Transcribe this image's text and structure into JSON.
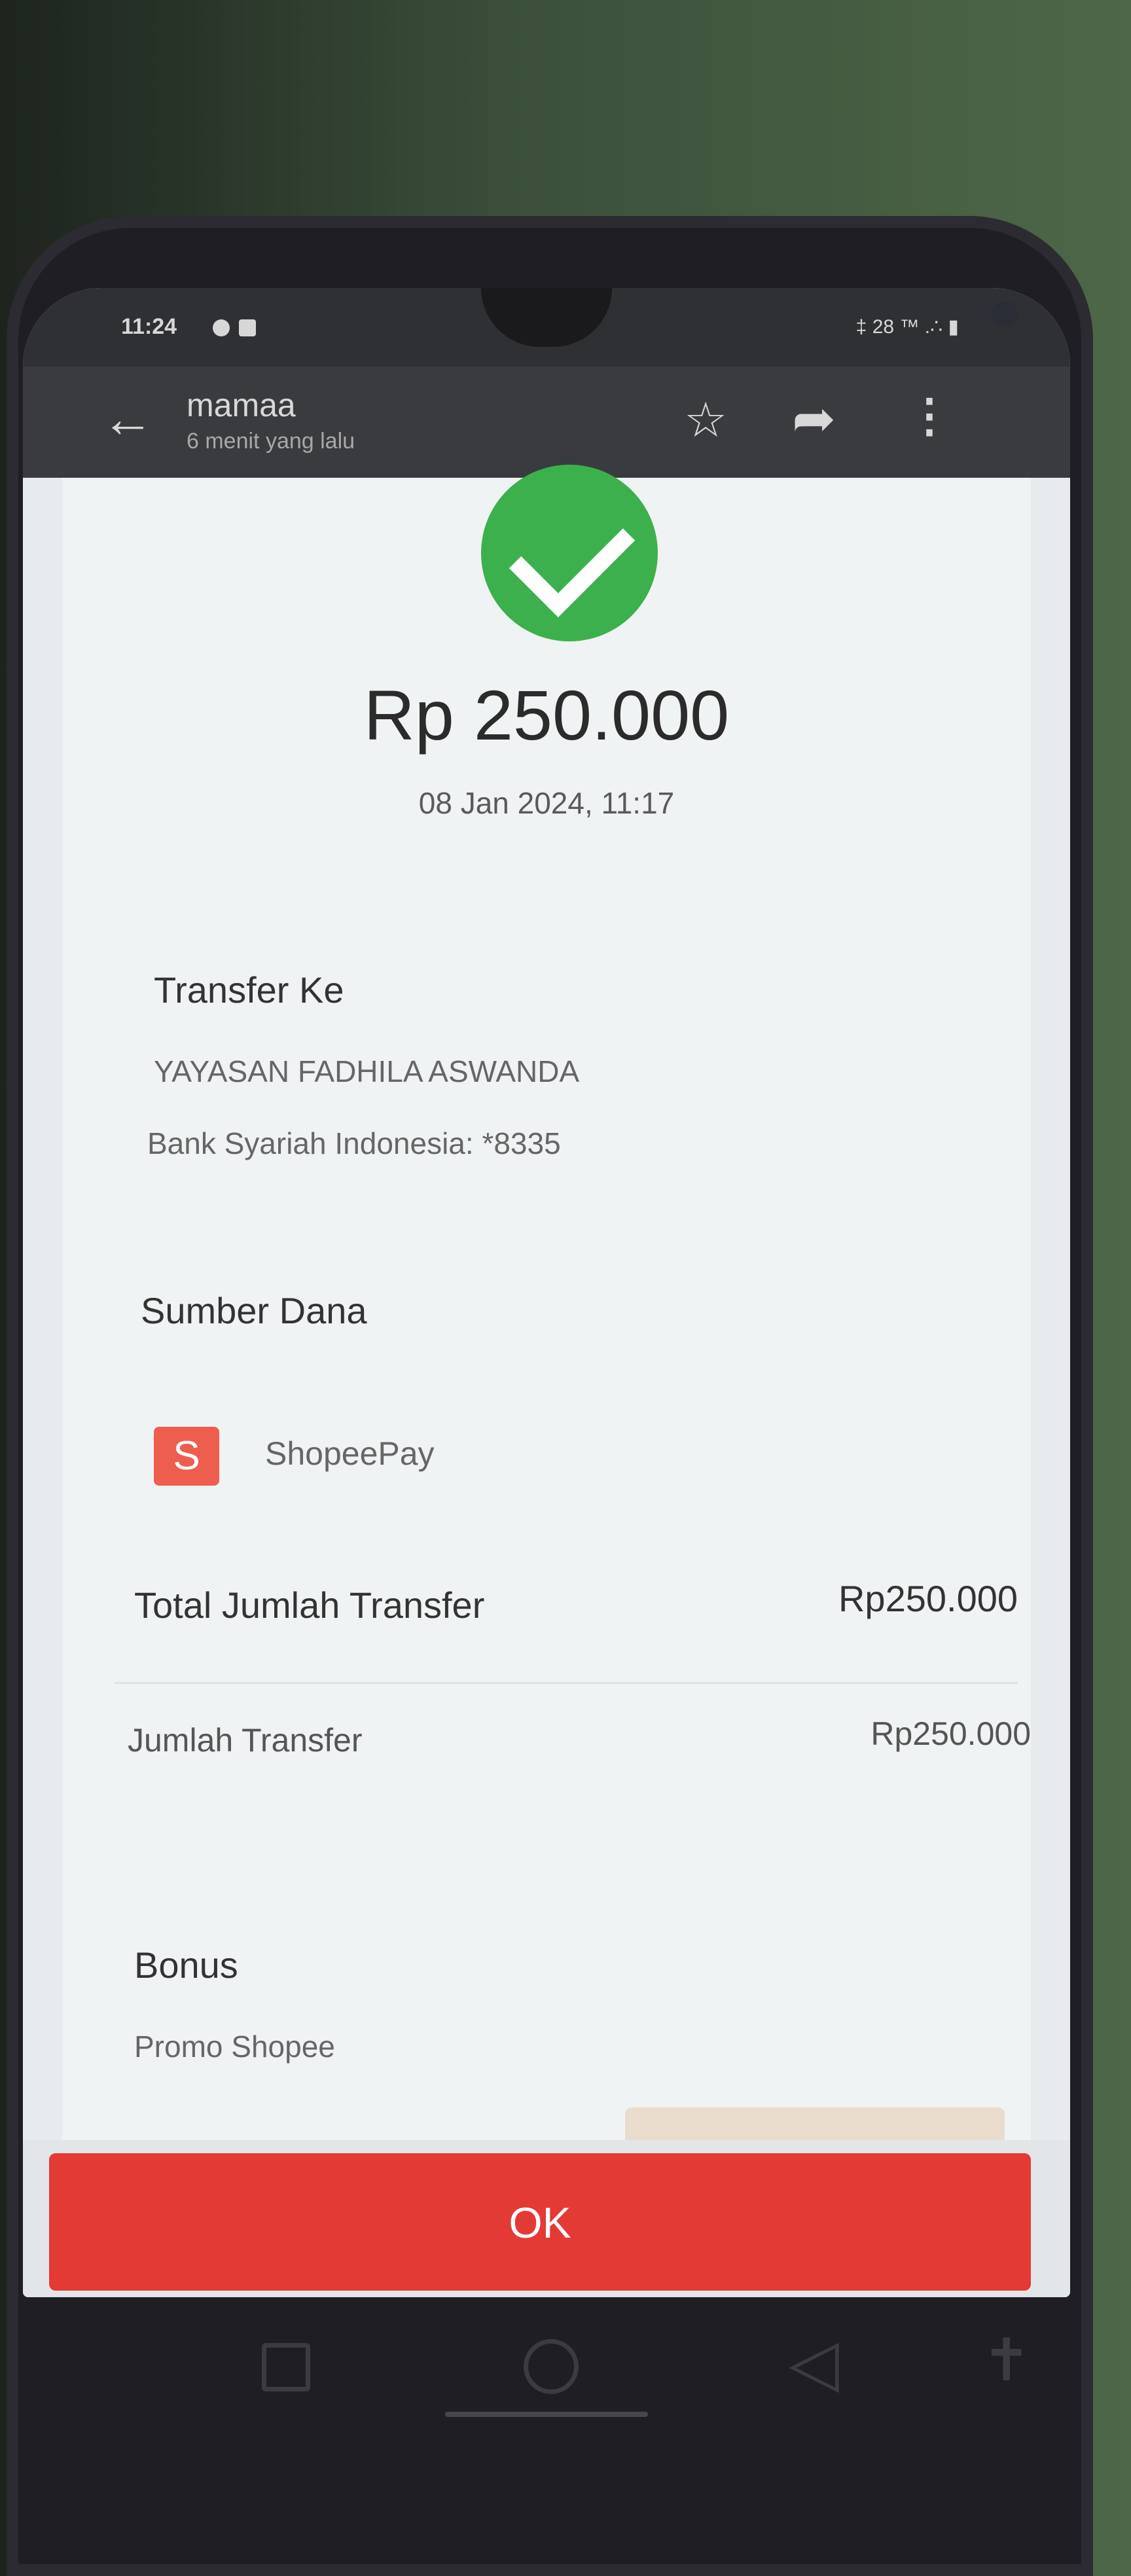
{
  "status_bar": {
    "time": "11:24",
    "right_indicators": "‡ 28 ™ .∴ ▮"
  },
  "app_bar": {
    "sender": "mamaa",
    "subtitle": "6 menit yang lalu",
    "back_icon": "arrow-left-icon",
    "star_icon": "star-outline-icon",
    "share_icon": "share-arrow-icon",
    "more_icon": "more-vertical-icon"
  },
  "receipt": {
    "amount": "Rp 250.000",
    "datetime": "08 Jan 2024, 11:17",
    "transfer_to": {
      "title": "Transfer Ke",
      "recipient": "YAYASAN FADHILA ASWANDA",
      "bank": "Bank Syariah Indonesia: *8335"
    },
    "source": {
      "title": "Sumber Dana",
      "logo_letter": "S",
      "name": "ShopeePay"
    },
    "totals": {
      "total_label": "Total Jumlah Transfer",
      "total_value": "Rp250.000",
      "amount_label": "Jumlah Transfer",
      "amount_value": "Rp250.000"
    },
    "bonus": {
      "title": "Bonus",
      "promo": "Promo Shopee"
    }
  },
  "actions": {
    "ok": "OK"
  },
  "colors": {
    "success": "#3cb04c",
    "primary": "#e43a35",
    "shopee": "#ee5e4f"
  }
}
